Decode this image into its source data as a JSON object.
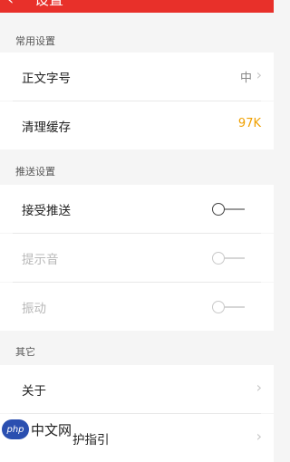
{
  "header": {
    "title": "设置",
    "back_icon": "‹",
    "background_color": "#e8302a"
  },
  "sections": {
    "common": {
      "title": "常用设置",
      "font_size_label": "正文字号",
      "font_size_value": "中",
      "cache_label": "清理缓存",
      "cache_value": "97K"
    },
    "push": {
      "title": "推送设置",
      "accept_push_label": "接受推送",
      "sound_label": "提示音",
      "vibrate_label": "振动"
    },
    "other": {
      "title": "其它",
      "about_label": "关于",
      "guide_label": "护指引"
    }
  },
  "watermark": {
    "badge": "php",
    "text": "中文网"
  },
  "colors": {
    "accent": "#e8302a",
    "cache_value": "#f0a000"
  }
}
